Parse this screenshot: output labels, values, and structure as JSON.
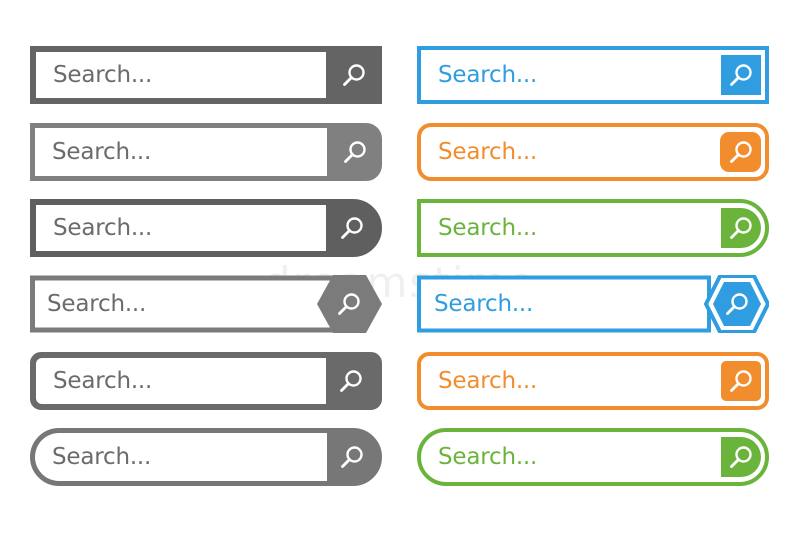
{
  "search_bars": [
    {
      "placeholder": "Search...",
      "color": "#646464"
    },
    {
      "placeholder": "Search...",
      "color": "#808080"
    },
    {
      "placeholder": "Search...",
      "color": "#5f5f5f"
    },
    {
      "placeholder": "Search...",
      "color": "#7b7b7b"
    },
    {
      "placeholder": "Search...",
      "color": "#6a6a6a"
    },
    {
      "placeholder": "Search...",
      "color": "#777777"
    },
    {
      "placeholder": "Search...",
      "color": "#2f9de0"
    },
    {
      "placeholder": "Search...",
      "color": "#f28d2d"
    },
    {
      "placeholder": "Search...",
      "color": "#6ab43c"
    },
    {
      "placeholder": "Search...",
      "color": "#2f9de0"
    },
    {
      "placeholder": "Search...",
      "color": "#f28d2d"
    },
    {
      "placeholder": "Search...",
      "color": "#6ab43c"
    }
  ],
  "icons": {
    "search_button": "magnifier-icon"
  },
  "watermark": "dreamstime"
}
